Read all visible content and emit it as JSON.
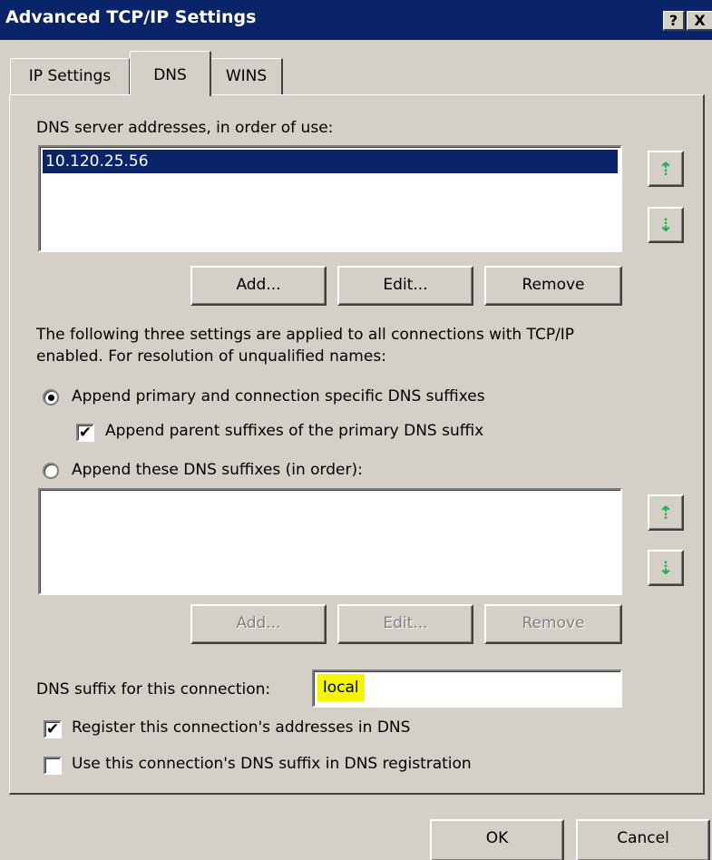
{
  "window": {
    "title": "Advanced TCP/IP Settings",
    "help_glyph": "?",
    "close_glyph": "X"
  },
  "tabs": [
    {
      "label": "IP Settings",
      "selected": false
    },
    {
      "label": "DNS",
      "selected": true
    },
    {
      "label": "WINS",
      "selected": false
    }
  ],
  "dns_servers": {
    "label": "DNS server addresses, in order of use:",
    "items": [
      "10.120.25.56"
    ],
    "selected_index": 0,
    "buttons": {
      "add": "Add...",
      "edit": "Edit...",
      "remove": "Remove"
    },
    "move_up_icon": "green-up-arrow-icon",
    "move_down_icon": "green-down-arrow-icon"
  },
  "info_text": {
    "line1": "The following three settings are applied to all connections with TCP/IP",
    "line2": "enabled. For resolution of unqualified names:"
  },
  "resolution": {
    "radio_primary_label": "Append primary and connection specific DNS suffixes",
    "radio_primary_selected": true,
    "check_parent_label": "Append parent suffixes of the primary DNS suffix",
    "check_parent_checked": true,
    "radio_these_label": "Append these DNS suffixes (in order):",
    "radio_these_selected": false
  },
  "suffix_list": {
    "items": [],
    "buttons": {
      "add": "Add...",
      "edit": "Edit...",
      "remove": "Remove"
    },
    "disabled": true
  },
  "connection_suffix": {
    "label": "DNS suffix for this connection:",
    "value": "local",
    "highlight_color": "#f5f500"
  },
  "registration": {
    "register_label": "Register this connection's addresses in DNS",
    "register_checked": true,
    "use_suffix_label": "Use this connection's DNS suffix in DNS registration",
    "use_suffix_checked": false
  },
  "footer": {
    "ok": "OK",
    "cancel": "Cancel"
  },
  "glyphs": {
    "check": "✔",
    "up": "⇡",
    "down": "⇣"
  },
  "colors": {
    "titlebar": "#0a246a",
    "dialog": "#d4d0c8",
    "selection": "#0a246a",
    "arrow": "#22b14c"
  }
}
